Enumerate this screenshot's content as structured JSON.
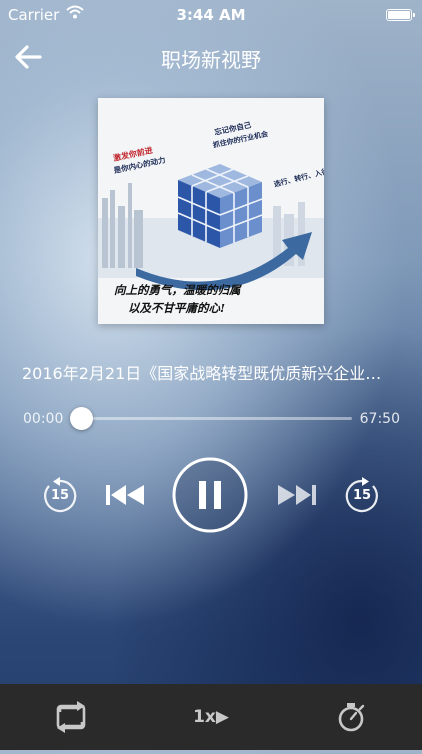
{
  "status_bar": {
    "carrier": "Carrier",
    "time": "3:44 AM"
  },
  "nav": {
    "title": "职场新视野"
  },
  "cover": {
    "text_top_left_1": "激发你前进",
    "text_top_left_2": "是你内心的动力",
    "text_top_right_1": "忘记你自己",
    "text_top_right_2": "抓住你的行业机会",
    "text_right": "选行、转行、入行",
    "text_bottom_1": "向上的勇气，温暖的归属",
    "text_bottom_2": "以及不甘平庸的心!"
  },
  "episode": {
    "title": "2016年2月21日《国家战略转型既优质新兴企业…"
  },
  "player": {
    "current_time": "00:00",
    "total_time": "67:50",
    "progress": 0,
    "skip_back_seconds": "15",
    "skip_forward_seconds": "15",
    "state": "playing"
  },
  "bottom_bar": {
    "speed_label": "1x▶"
  }
}
